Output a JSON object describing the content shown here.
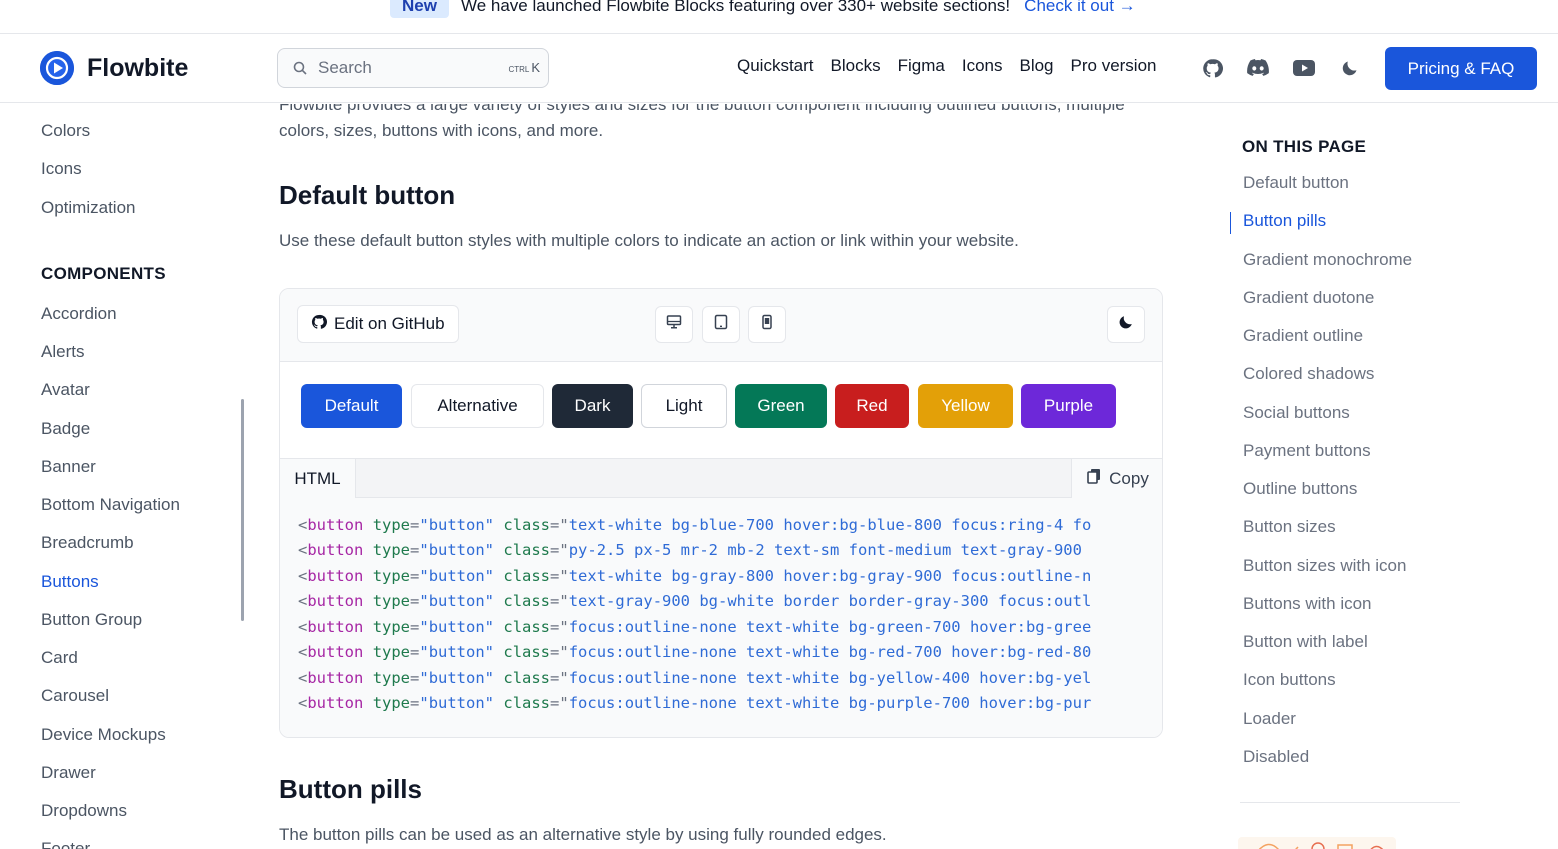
{
  "banner": {
    "badge": "New",
    "text": "We have launched Flowbite Blocks featuring over 330+ website sections!",
    "link": "Check it out →"
  },
  "navbar": {
    "brand": "Flowbite",
    "search_placeholder": "Search",
    "shortcut_ctrl": "CTRL",
    "shortcut_key": "K",
    "links": [
      "Quickstart",
      "Blocks",
      "Figma",
      "Icons",
      "Blog",
      "Pro version"
    ],
    "icons": [
      "github-icon",
      "discord-icon",
      "youtube-icon",
      "dark-mode-icon"
    ],
    "cta": "Pricing & FAQ"
  },
  "sidebar": {
    "top_items": [
      "Colors",
      "Icons",
      "Optimization"
    ],
    "components_heading": "COMPONENTS",
    "components": [
      "Accordion",
      "Alerts",
      "Avatar",
      "Badge",
      "Banner",
      "Bottom Navigation",
      "Breadcrumb",
      "Buttons",
      "Button Group",
      "Card",
      "Carousel",
      "Device Mockups",
      "Drawer",
      "Dropdowns",
      "Footer"
    ],
    "active": "Buttons"
  },
  "main": {
    "intro": "Flowbite provides a large variety of styles and sizes for the button component including outlined buttons, multiple colors, sizes, buttons with icons, and more.",
    "section1_title": "Default button",
    "section1_desc": "Use these default button styles with multiple colors to indicate an action or link within your website.",
    "edit_github": "Edit on GitHub",
    "preview_buttons": [
      {
        "label": "Default",
        "bg": "#1a56db",
        "color": "#ffffff"
      },
      {
        "label": "Alternative",
        "bg": "#ffffff",
        "color": "#111827"
      },
      {
        "label": "Dark",
        "bg": "#1f2937",
        "color": "#ffffff"
      },
      {
        "label": "Light",
        "bg": "#ffffff",
        "color": "#111827"
      },
      {
        "label": "Green",
        "bg": "#047857",
        "color": "#ffffff"
      },
      {
        "label": "Red",
        "bg": "#c81e1e",
        "color": "#ffffff"
      },
      {
        "label": "Yellow",
        "bg": "#e3a008",
        "color": "#ffffff"
      },
      {
        "label": "Purple",
        "bg": "#6d28d9",
        "color": "#ffffff"
      }
    ],
    "code_tab": "HTML",
    "copy": "Copy",
    "code_lines": [
      "text-white bg-blue-700 hover:bg-blue-800 focus:ring-4 fo",
      "py-2.5 px-5 mr-2 mb-2 text-sm font-medium text-gray-900 ",
      "text-white bg-gray-800 hover:bg-gray-900 focus:outline-n",
      "text-gray-900 bg-white border border-gray-300 focus:outl",
      "focus:outline-none text-white bg-green-700 hover:bg-gree",
      "focus:outline-none text-white bg-red-700 hover:bg-red-80",
      "focus:outline-none text-white bg-yellow-400 hover:bg-yel",
      "focus:outline-none text-white bg-purple-700 hover:bg-pur"
    ],
    "code_tag": "button",
    "code_attr_type": "type",
    "code_attr_type_value": "\"button\"",
    "code_attr_class": "class",
    "section2_title": "Button pills",
    "section2_desc": "The button pills can be used as an alternative style by using fully rounded edges."
  },
  "toc": {
    "title": "ON THIS PAGE",
    "items": [
      "Default button",
      "Button pills",
      "Gradient monochrome",
      "Gradient duotone",
      "Gradient outline",
      "Colored shadows",
      "Social buttons",
      "Payment buttons",
      "Outline buttons",
      "Button sizes",
      "Button sizes with icon",
      "Buttons with icon",
      "Button with label",
      "Icon buttons",
      "Loader",
      "Disabled"
    ],
    "active": "Button pills"
  },
  "colors": {
    "accent": "#1a56db",
    "text": "#111827",
    "muted": "#4b5563"
  }
}
